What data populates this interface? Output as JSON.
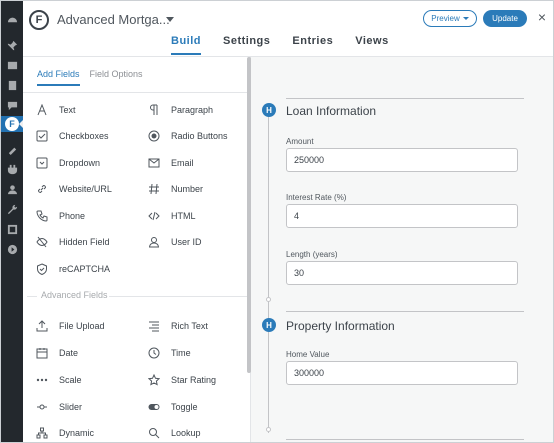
{
  "header": {
    "form_title": "Advanced Mortga...",
    "logo_letter": "F",
    "nav": [
      "Build",
      "Settings",
      "Entries",
      "Views"
    ],
    "preview_label": "Preview",
    "update_label": "Update",
    "close_glyph": "×"
  },
  "panel": {
    "tabs": [
      "Add Fields",
      "Field Options"
    ],
    "fields": [
      {
        "label": "Text",
        "icon": "text-icon"
      },
      {
        "label": "Paragraph",
        "icon": "paragraph-icon"
      },
      {
        "label": "Checkboxes",
        "icon": "checkbox-icon"
      },
      {
        "label": "Radio Buttons",
        "icon": "radio-icon"
      },
      {
        "label": "Dropdown",
        "icon": "dropdown-icon"
      },
      {
        "label": "Email",
        "icon": "email-icon"
      },
      {
        "label": "Website/URL",
        "icon": "link-icon"
      },
      {
        "label": "Number",
        "icon": "hash-icon"
      },
      {
        "label": "Phone",
        "icon": "phone-icon"
      },
      {
        "label": "HTML",
        "icon": "code-icon"
      },
      {
        "label": "Hidden Field",
        "icon": "eye-slash-icon"
      },
      {
        "label": "User ID",
        "icon": "user-icon"
      },
      {
        "label": "reCAPTCHA",
        "icon": "shield-icon"
      }
    ],
    "advanced_heading": "Advanced Fields",
    "advanced_fields": [
      {
        "label": "File Upload",
        "icon": "upload-icon"
      },
      {
        "label": "Rich Text",
        "icon": "align-icon"
      },
      {
        "label": "Date",
        "icon": "calendar-icon"
      },
      {
        "label": "Time",
        "icon": "clock-icon"
      },
      {
        "label": "Scale",
        "icon": "dots-icon"
      },
      {
        "label": "Star Rating",
        "icon": "star-icon"
      },
      {
        "label": "Slider",
        "icon": "slider-icon"
      },
      {
        "label": "Toggle",
        "icon": "toggle-icon"
      },
      {
        "label": "Dynamic",
        "icon": "sitemap-icon"
      },
      {
        "label": "Lookup",
        "icon": "search-icon"
      }
    ]
  },
  "canvas": {
    "badge_letter": "H",
    "sections": [
      {
        "title": "Loan Information",
        "fields": [
          {
            "label": "Amount",
            "value": "250000"
          },
          {
            "label": "Interest Rate (%)",
            "value": "4"
          },
          {
            "label": "Length (years)",
            "value": "30"
          }
        ]
      },
      {
        "title": "Property Information",
        "fields": [
          {
            "label": "Home Value",
            "value": "300000"
          }
        ]
      }
    ]
  },
  "colors": {
    "accent": "#2b7bb9",
    "wp_sidebar": "#23282d"
  }
}
